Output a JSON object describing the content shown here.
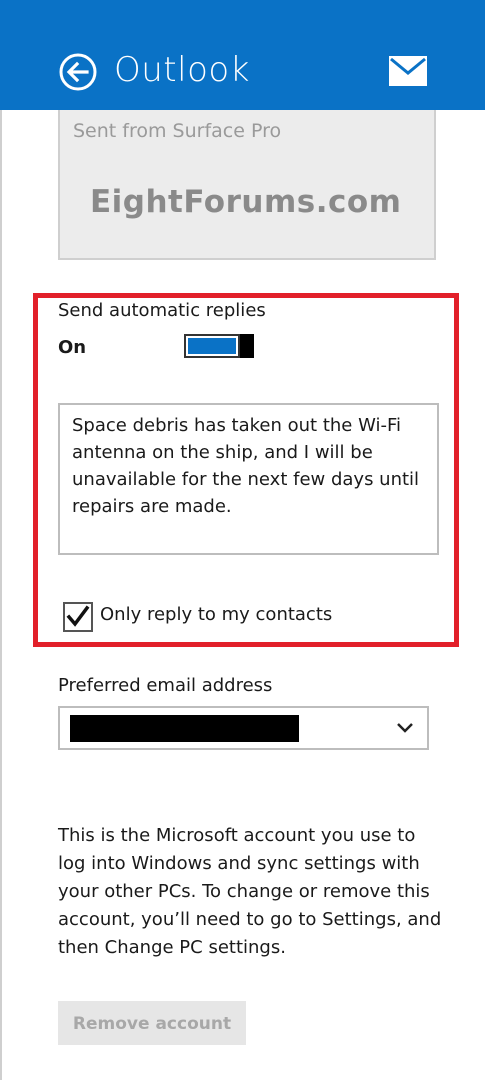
{
  "header": {
    "title": "Outlook",
    "back_icon": "back-arrow-circle-icon",
    "mail_icon": "mail-envelope-icon",
    "accent_color": "#0a72c6"
  },
  "signature": {
    "text": "Sent from Surface Pro",
    "watermark": "EightForums.com"
  },
  "automatic_replies": {
    "label": "Send automatic replies",
    "state_label": "On",
    "toggle_on": true,
    "message": "Space debris has taken out the Wi-Fi antenna on the ship, and I will be unavailable for the next few days until repairs are made.",
    "only_contacts_label": "Only reply to my contacts",
    "only_contacts_checked": true,
    "highlight_color": "#e2202a"
  },
  "preferred_email": {
    "label": "Preferred email address",
    "value_redacted": true
  },
  "account_info": {
    "text": "This is the Microsoft account you use to log into Windows and sync settings with your other PCs. To change or remove this account, you’ll need to go to Settings, and then Change PC settings."
  },
  "remove_account": {
    "label": "Remove account"
  }
}
